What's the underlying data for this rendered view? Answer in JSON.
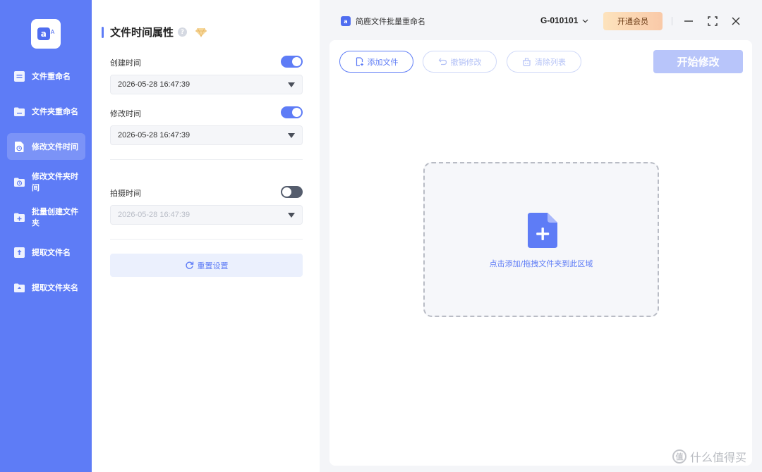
{
  "app": {
    "title": "简鹿文件批量重命名",
    "logo_text": "a",
    "logo_sub": "A"
  },
  "sidebar": {
    "items": [
      {
        "label": "文件重命名",
        "icon": "file-list-icon"
      },
      {
        "label": "文件夹重命名",
        "icon": "folder-icon"
      },
      {
        "label": "修改文件时间",
        "icon": "file-clock-icon",
        "active": true
      },
      {
        "label": "修改文件夹时间",
        "icon": "folder-clock-icon"
      },
      {
        "label": "批量创建文件夹",
        "icon": "folder-plus-icon"
      },
      {
        "label": "提取文件名",
        "icon": "file-upload-icon"
      },
      {
        "label": "提取文件夹名",
        "icon": "folder-upload-icon"
      }
    ]
  },
  "panel": {
    "title": "文件时间属性",
    "help": "?",
    "fields": [
      {
        "label": "创建时间",
        "enabled": true,
        "value": "2026-05-28 16:47:39"
      },
      {
        "label": "修改时间",
        "enabled": true,
        "value": "2026-05-28 16:47:39"
      },
      {
        "label": "拍摄时间",
        "enabled": false,
        "value": "2026-05-28 16:47:39"
      }
    ],
    "reset_label": "重置设置"
  },
  "header": {
    "account": "G-010101",
    "vip_label": "开通会员"
  },
  "toolbar": {
    "add_file": "添加文件",
    "undo": "撤销修改",
    "clear": "清除列表",
    "start": "开始修改"
  },
  "dropzone": {
    "hint": "点击添加/拖拽文件夹到此区域"
  },
  "watermark": {
    "text": "什么值得买",
    "mark": "值"
  },
  "colors": {
    "accent": "#5e7cf6",
    "sidebar": "#5e7cf6",
    "vip_gradient_start": "#fde3bd",
    "vip_gradient_end": "#f9c9a8"
  }
}
